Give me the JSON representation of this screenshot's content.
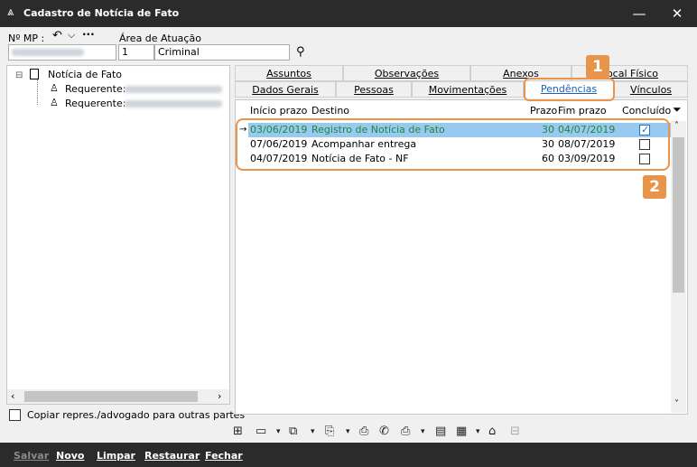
{
  "window": {
    "title": "Cadastro de Notícia de Fato",
    "app_icon": "triangle-logo-icon"
  },
  "header": {
    "mp_label": "Nº MP :",
    "area_label": "Área de Atuação",
    "area_code": "1",
    "area_name": "Criminal"
  },
  "tree": {
    "root": "Notícia de Fato",
    "children": [
      {
        "label": "Requerente:"
      },
      {
        "label": "Requerente:"
      }
    ]
  },
  "copy_checkbox_label": "Copiar repres./advogado para outras partes",
  "tabs": {
    "row1": [
      "Assuntos",
      "Observações",
      "Anexos",
      "Local Físico"
    ],
    "row2": [
      "Dados Gerais",
      "Pessoas",
      "Movimentações",
      "Pendências",
      "Vínculos"
    ],
    "active": "Pendências"
  },
  "grid": {
    "columns": [
      "Início prazo",
      "Destino",
      "Prazo",
      "Fim prazo",
      "Concluído"
    ],
    "rows": [
      {
        "inicio": "03/06/2019",
        "destino": "Registro de Notícia de Fato",
        "prazo": "30",
        "fim": "04/07/2019",
        "concluido": true
      },
      {
        "inicio": "07/06/2019",
        "destino": "Acompanhar entrega",
        "prazo": "30",
        "fim": "08/07/2019",
        "concluido": false
      },
      {
        "inicio": "04/07/2019",
        "destino": "Notícia de Fato - NF",
        "prazo": "60",
        "fim": "03/09/2019",
        "concluido": false
      }
    ]
  },
  "callouts": {
    "one": "1",
    "two": "2"
  },
  "footer": {
    "salvar": "Salvar",
    "novo": "Novo",
    "limpar": "Limpar",
    "restaurar": "Restaurar",
    "fechar": "Fechar"
  },
  "colors": {
    "titlebar": "#2b2b2b",
    "selected_row": "#99c9ef",
    "selected_text": "#1a8a3a",
    "callout": "#e8944a",
    "active_tab": "#1a62b8"
  }
}
